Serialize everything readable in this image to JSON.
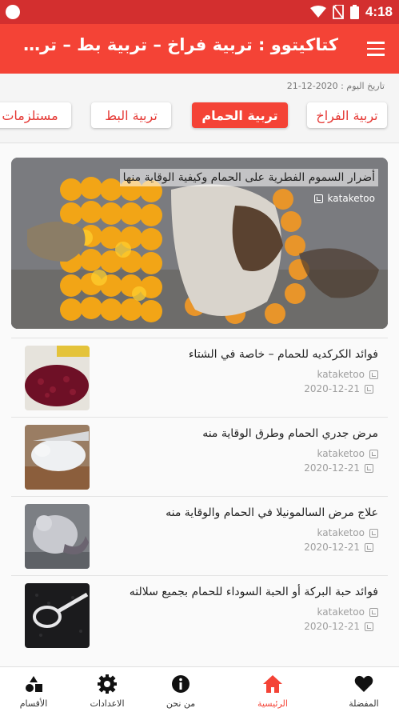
{
  "status_bar": {
    "time": "4:18",
    "icons": [
      "circle-notification-icon",
      "wifi-icon",
      "no-sim-icon",
      "battery-icon"
    ]
  },
  "app_bar": {
    "title": "كتاكيتوو : تربية فراخ – تربية بط – تربية…",
    "menu_icon": "hamburger-menu-icon"
  },
  "date_line": "تاريخ اليوم : 2020-12-21",
  "categories": [
    {
      "label": "تربية الفراخ",
      "active": false
    },
    {
      "label": "تربية الحمام",
      "active": true
    },
    {
      "label": "تربية البط",
      "active": false
    },
    {
      "label": "مستلزمات",
      "active": false
    }
  ],
  "featured": {
    "title": "أضرار السموم الفطرية على الحمام وكيفية الوقاية منها",
    "source": "kataketoo"
  },
  "articles": [
    {
      "title": "فوائد الكركديه للحمام – خاصة في الشتاء",
      "source": "kataketoo",
      "date": "2020-12-21"
    },
    {
      "title": "مرض جدري الحمام وطرق الوقاية منه",
      "source": "kataketoo",
      "date": "2020-12-21"
    },
    {
      "title": "علاج مرض السالمونيلا في الحمام والوقاية منه",
      "source": "kataketoo",
      "date": "2020-12-21"
    },
    {
      "title": "فوائد حبة البركة أو الحبة السوداء للحمام بجميع سلالته",
      "source": "kataketoo",
      "date": "2020-12-21"
    }
  ],
  "bottom_nav": [
    {
      "label": "الأقسام",
      "icon": "categories-shapes-icon",
      "active": false
    },
    {
      "label": "الاعدادات",
      "icon": "settings-gear-icon",
      "active": false
    },
    {
      "label": "من نحن",
      "icon": "info-icon",
      "active": false
    },
    {
      "label": "الرئيسية",
      "icon": "home-icon",
      "active": true
    },
    {
      "label": "المفضلة",
      "icon": "heart-icon",
      "active": false
    }
  ],
  "colors": {
    "status_bar": "#d32f2f",
    "app_bar": "#f44336",
    "accent": "#f44336",
    "muted_text": "#9e9e9e"
  }
}
